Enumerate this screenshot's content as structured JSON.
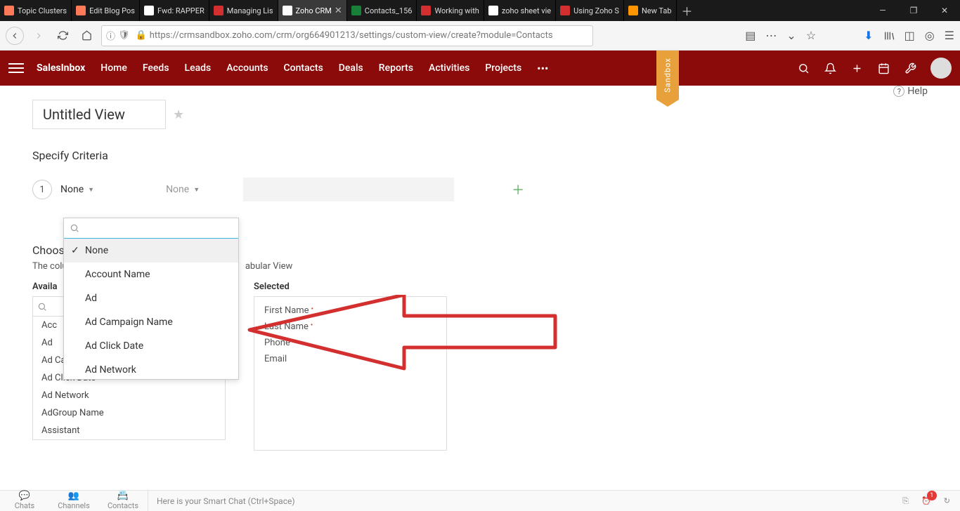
{
  "browser": {
    "tabs": [
      {
        "label": "Topic Clusters",
        "favicon": "ff-hubspot"
      },
      {
        "label": "Edit Blog Pos",
        "favicon": "ff-hubspot"
      },
      {
        "label": "Fwd: RAPPER",
        "favicon": "ff-gmail"
      },
      {
        "label": "Managing Lis",
        "favicon": "ff-zoho-red"
      },
      {
        "label": "Zoho CRM",
        "favicon": "ff-zoho-crm",
        "active": true
      },
      {
        "label": "Contacts_156",
        "favicon": "ff-sheets"
      },
      {
        "label": "Working with",
        "favicon": "ff-zoho-red"
      },
      {
        "label": "zoho sheet vie",
        "favicon": "ff-google"
      },
      {
        "label": "Using Zoho S",
        "favicon": "ff-zoho-red"
      },
      {
        "label": "New Tab",
        "favicon": "ff-firefox"
      }
    ],
    "url": "https://crmsandbox.zoho.com/crm/org664901213/settings/custom-view/create?module=Contacts"
  },
  "app": {
    "nav": [
      "SalesInbox",
      "Home",
      "Feeds",
      "Leads",
      "Accounts",
      "Contacts",
      "Deals",
      "Reports",
      "Activities",
      "Projects"
    ],
    "sandbox_label": "Sandbox",
    "help": "Help"
  },
  "view": {
    "title": "Untitled View",
    "criteria_heading": "Specify Criteria",
    "row": {
      "index": "1",
      "field": "None",
      "cond": "None"
    },
    "dropdown": {
      "search_placeholder": "",
      "items": [
        "None",
        "Account Name",
        "Ad",
        "Ad Campaign Name",
        "Ad Click Date",
        "Ad Network"
      ]
    },
    "columns": {
      "heading_prefix": "Choos",
      "desc_prefix": "The colu",
      "desc_suffix": "abular View",
      "available_label": "Availa",
      "selected_label": "Selected",
      "available": [
        "Acc",
        "Ad",
        "Ad Campaign Name",
        "Ad Click Date",
        "Ad Network",
        "AdGroup Name",
        "Assistant"
      ],
      "selected": [
        {
          "t": "First Name",
          "r": true
        },
        {
          "t": "Last Name",
          "r": true
        },
        {
          "t": "Phone",
          "r": false
        },
        {
          "t": "Email",
          "r": false
        }
      ]
    }
  },
  "bottom": {
    "items": [
      "Chats",
      "Channels",
      "Contacts"
    ],
    "smart": "Here is your Smart Chat (Ctrl+Space)"
  }
}
